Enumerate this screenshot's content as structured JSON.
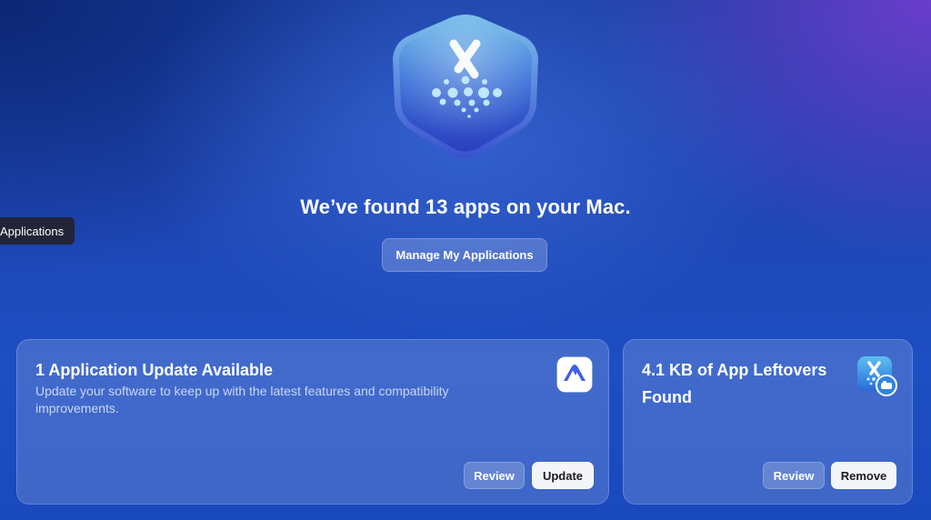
{
  "hero": {
    "icon": "app-cleaner-hexagon-icon",
    "headline": "We’ve found 13 apps on your Mac.",
    "manage_button": "Manage My Applications"
  },
  "tooltip": {
    "text": "Applications"
  },
  "cards": {
    "updates": {
      "title": "1 Application Update Available",
      "description": "Update your software to keep up with the latest features and compatibility improvements.",
      "icon": "nordvpn-app-icon",
      "review_label": "Review",
      "primary_label": "Update"
    },
    "leftovers": {
      "title": "4.1 KB of App Leftovers Found",
      "icon": "app-leftovers-icon",
      "review_label": "Review",
      "primary_label": "Remove"
    }
  },
  "colors": {
    "background_top": "#1a3fa3",
    "background_bottom": "#1a49bd",
    "accent_purple": "#6a3fd0",
    "primary_button": "#f4f5f8"
  }
}
